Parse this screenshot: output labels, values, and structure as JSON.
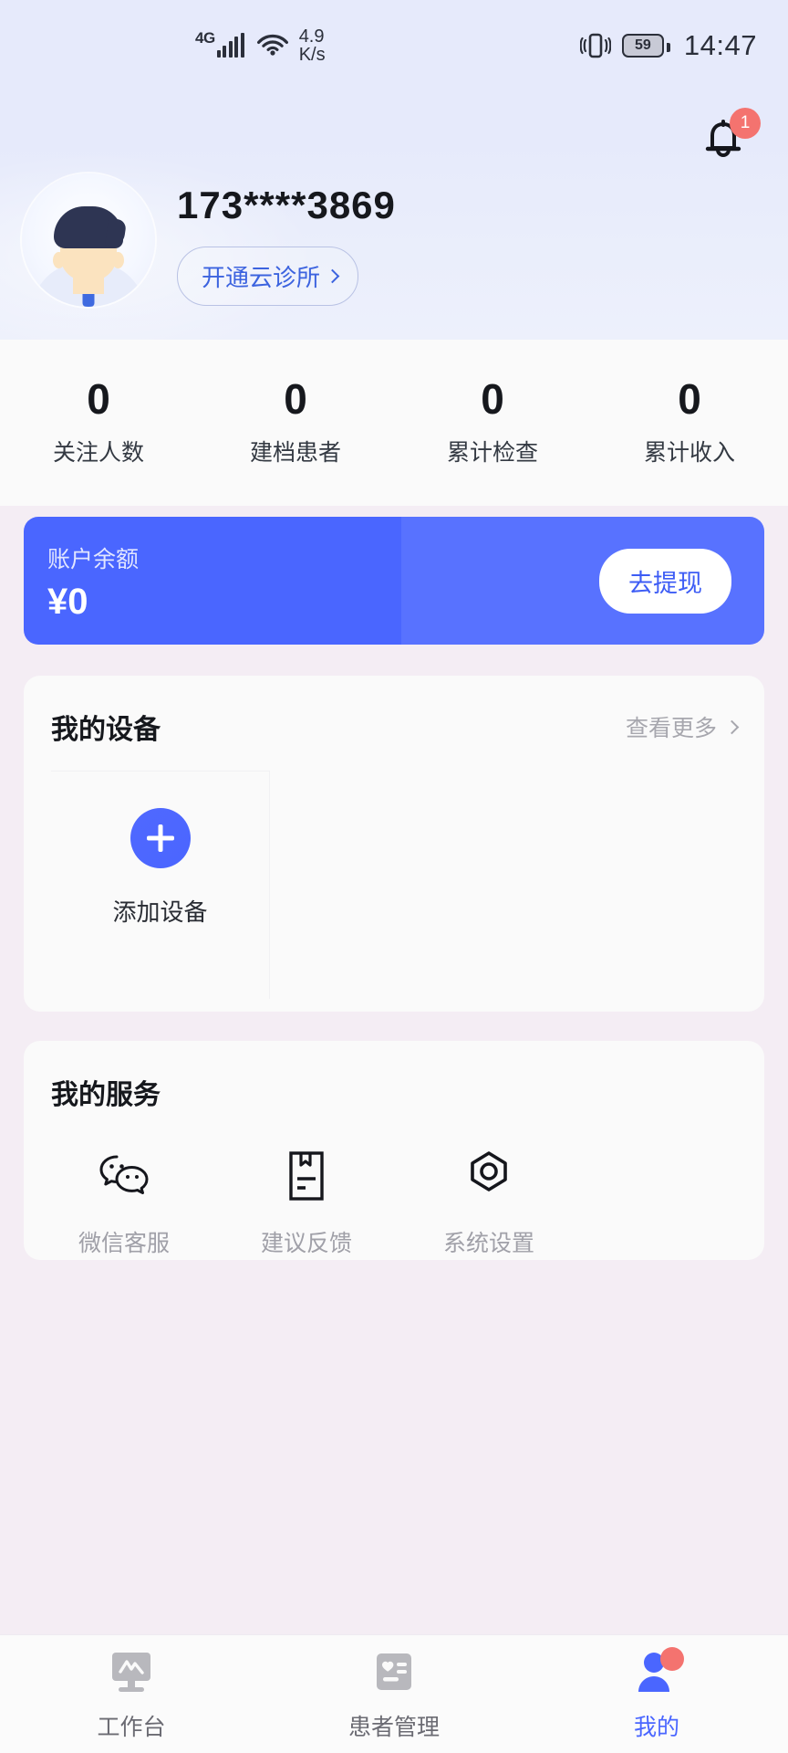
{
  "status_bar": {
    "network_type": "4G",
    "speed_value": "4.9",
    "speed_unit": "K/s",
    "battery_level": "59",
    "time": "14:47"
  },
  "header": {
    "notification_badge": "1",
    "phone": "173****3869",
    "clinic_button": "开通云诊所"
  },
  "stats": [
    {
      "value": "0",
      "label": "关注人数"
    },
    {
      "value": "0",
      "label": "建档患者"
    },
    {
      "value": "0",
      "label": "累计检查"
    },
    {
      "value": "0",
      "label": "累计收入"
    }
  ],
  "balance": {
    "label": "账户余额",
    "amount": "¥0",
    "withdraw_button": "去提现",
    "color": "#4a66ff"
  },
  "devices": {
    "title": "我的设备",
    "more_label": "查看更多",
    "add_label": "添加设备"
  },
  "services": {
    "title": "我的服务",
    "items": [
      {
        "label": "微信客服",
        "icon": "wechat-icon"
      },
      {
        "label": "建议反馈",
        "icon": "feedback-document-icon"
      },
      {
        "label": "系统设置",
        "icon": "hex-nut-settings-icon"
      }
    ]
  },
  "tabbar": {
    "items": [
      {
        "label": "工作台",
        "icon": "monitor-chart-icon",
        "active": false
      },
      {
        "label": "患者管理",
        "icon": "patient-card-icon",
        "active": false
      },
      {
        "label": "我的",
        "icon": "person-icon",
        "active": true
      }
    ],
    "active_color": "#4a66ff"
  }
}
